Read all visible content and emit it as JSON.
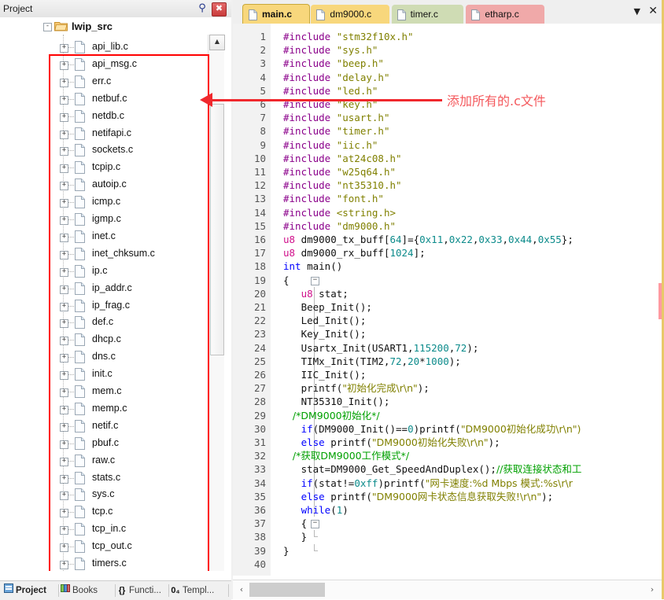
{
  "project_panel": {
    "title": "Project",
    "pin_icon": "pin-icon",
    "close_icon": "close-icon",
    "root": {
      "label": "lwip_src",
      "expander": "-",
      "icon": "folder-icon"
    },
    "files": [
      "api_lib.c",
      "api_msg.c",
      "err.c",
      "netbuf.c",
      "netdb.c",
      "netifapi.c",
      "sockets.c",
      "tcpip.c",
      "autoip.c",
      "icmp.c",
      "igmp.c",
      "inet.c",
      "inet_chksum.c",
      "ip.c",
      "ip_addr.c",
      "ip_frag.c",
      "def.c",
      "dhcp.c",
      "dns.c",
      "init.c",
      "mem.c",
      "memp.c",
      "netif.c",
      "pbuf.c",
      "raw.c",
      "stats.c",
      "sys.c",
      "tcp.c",
      "tcp_in.c",
      "tcp_out.c",
      "timers.c"
    ],
    "expander_symbol": "+",
    "scrollbar": {
      "up_arrow": "▲",
      "down_arrow": "▼"
    },
    "bottom_tabs": [
      {
        "label": "Project",
        "icon": "project-icon",
        "active": true
      },
      {
        "label": "Books",
        "icon": "books-icon",
        "active": false
      },
      {
        "label": "Functi...",
        "icon": "{}",
        "active": false
      },
      {
        "label": "Templ...",
        "icon": "0₄",
        "active": false
      }
    ]
  },
  "editor": {
    "tabs": [
      {
        "label": "main.c",
        "color": "#f8d77c",
        "active": true
      },
      {
        "label": "dm9000.c",
        "color": "#f8d77c",
        "active": false
      },
      {
        "label": "timer.c",
        "color": "#cfdcb4",
        "active": false
      },
      {
        "label": "etharp.c",
        "color": "#f0a9a9",
        "active": false
      }
    ],
    "tab_menu_icon": "chevron-down-icon",
    "tab_close_icon": "close-icon",
    "hscroll": {
      "left_arrow": "‹",
      "right_arrow": "›"
    },
    "lines": [
      {
        "n": 1,
        "segs": [
          {
            "t": "#include ",
            "c": "k-pre"
          },
          {
            "t": "\"stm32f10x.h\"",
            "c": "k-str"
          }
        ]
      },
      {
        "n": 2,
        "segs": [
          {
            "t": "#include ",
            "c": "k-pre"
          },
          {
            "t": "\"sys.h\"",
            "c": "k-str"
          }
        ]
      },
      {
        "n": 3,
        "segs": [
          {
            "t": "#include ",
            "c": "k-pre"
          },
          {
            "t": "\"beep.h\"",
            "c": "k-str"
          }
        ]
      },
      {
        "n": 4,
        "segs": [
          {
            "t": "#include ",
            "c": "k-pre"
          },
          {
            "t": "\"delay.h\"",
            "c": "k-str"
          }
        ]
      },
      {
        "n": 5,
        "segs": [
          {
            "t": "#include ",
            "c": "k-pre"
          },
          {
            "t": "\"led.h\"",
            "c": "k-str"
          }
        ]
      },
      {
        "n": 6,
        "segs": [
          {
            "t": "#include ",
            "c": "k-pre"
          },
          {
            "t": "\"key.h\"",
            "c": "k-str"
          }
        ]
      },
      {
        "n": 7,
        "segs": [
          {
            "t": "#include ",
            "c": "k-pre"
          },
          {
            "t": "\"usart.h\"",
            "c": "k-str"
          }
        ]
      },
      {
        "n": 8,
        "segs": [
          {
            "t": "#include ",
            "c": "k-pre"
          },
          {
            "t": "\"timer.h\"",
            "c": "k-str"
          }
        ]
      },
      {
        "n": 9,
        "segs": [
          {
            "t": "#include ",
            "c": "k-pre"
          },
          {
            "t": "\"iic.h\"",
            "c": "k-str"
          }
        ]
      },
      {
        "n": 10,
        "segs": [
          {
            "t": "#include ",
            "c": "k-pre"
          },
          {
            "t": "\"at24c08.h\"",
            "c": "k-str"
          }
        ]
      },
      {
        "n": 11,
        "segs": [
          {
            "t": "#include ",
            "c": "k-pre"
          },
          {
            "t": "\"w25q64.h\"",
            "c": "k-str"
          }
        ]
      },
      {
        "n": 12,
        "segs": [
          {
            "t": "#include ",
            "c": "k-pre"
          },
          {
            "t": "\"nt35310.h\"",
            "c": "k-str"
          }
        ]
      },
      {
        "n": 13,
        "segs": [
          {
            "t": "#include ",
            "c": "k-pre"
          },
          {
            "t": "\"font.h\"",
            "c": "k-str"
          }
        ]
      },
      {
        "n": 14,
        "segs": [
          {
            "t": "#include ",
            "c": "k-pre"
          },
          {
            "t": "<string.h>",
            "c": "k-str"
          }
        ]
      },
      {
        "n": 15,
        "segs": [
          {
            "t": "#include ",
            "c": "k-pre"
          },
          {
            "t": "\"dm9000.h\"",
            "c": "k-str"
          }
        ]
      },
      {
        "n": 16,
        "segs": [
          {
            "t": "u8",
            "c": "k-type"
          },
          {
            "t": " dm9000_tx_buff[",
            "c": "k-txt"
          },
          {
            "t": "64",
            "c": "k-num"
          },
          {
            "t": "]={",
            "c": "k-txt"
          },
          {
            "t": "0x11",
            "c": "k-num"
          },
          {
            "t": ",",
            "c": "k-txt"
          },
          {
            "t": "0x22",
            "c": "k-num"
          },
          {
            "t": ",",
            "c": "k-txt"
          },
          {
            "t": "0x33",
            "c": "k-num"
          },
          {
            "t": ",",
            "c": "k-txt"
          },
          {
            "t": "0x44",
            "c": "k-num"
          },
          {
            "t": ",",
            "c": "k-txt"
          },
          {
            "t": "0x55",
            "c": "k-num"
          },
          {
            "t": "};",
            "c": "k-txt"
          }
        ]
      },
      {
        "n": 17,
        "segs": [
          {
            "t": "u8",
            "c": "k-type"
          },
          {
            "t": " dm9000_rx_buff[",
            "c": "k-txt"
          },
          {
            "t": "1024",
            "c": "k-num"
          },
          {
            "t": "];",
            "c": "k-txt"
          }
        ]
      },
      {
        "n": 18,
        "segs": [
          {
            "t": "int",
            "c": "k-kw"
          },
          {
            "t": " main()",
            "c": "k-txt"
          }
        ]
      },
      {
        "n": 19,
        "segs": [
          {
            "t": "{",
            "c": "k-txt"
          }
        ],
        "fold": "start"
      },
      {
        "n": 20,
        "segs": [
          {
            "t": "   ",
            "c": "k-txt"
          },
          {
            "t": "u8",
            "c": "k-type"
          },
          {
            "t": " stat;",
            "c": "k-txt"
          }
        ],
        "fold": "body"
      },
      {
        "n": 21,
        "segs": [
          {
            "t": "   Beep_Init();",
            "c": "k-txt"
          }
        ],
        "fold": "body"
      },
      {
        "n": 22,
        "segs": [
          {
            "t": "   Led_Init();",
            "c": "k-txt"
          }
        ],
        "fold": "body"
      },
      {
        "n": 23,
        "segs": [
          {
            "t": "   Key_Init();",
            "c": "k-txt"
          }
        ],
        "fold": "body"
      },
      {
        "n": 24,
        "segs": [
          {
            "t": "   Usartx_Init(USART1,",
            "c": "k-txt"
          },
          {
            "t": "115200",
            "c": "k-num"
          },
          {
            "t": ",",
            "c": "k-txt"
          },
          {
            "t": "72",
            "c": "k-num"
          },
          {
            "t": ");",
            "c": "k-txt"
          }
        ],
        "fold": "body"
      },
      {
        "n": 25,
        "segs": [
          {
            "t": "   TIMx_Init(TIM2,",
            "c": "k-txt"
          },
          {
            "t": "72",
            "c": "k-num"
          },
          {
            "t": ",",
            "c": "k-txt"
          },
          {
            "t": "20",
            "c": "k-num"
          },
          {
            "t": "*",
            "c": "k-txt"
          },
          {
            "t": "1000",
            "c": "k-num"
          },
          {
            "t": ");",
            "c": "k-txt"
          }
        ],
        "fold": "body"
      },
      {
        "n": 26,
        "segs": [
          {
            "t": "   IIC_Init();",
            "c": "k-txt"
          }
        ],
        "fold": "body"
      },
      {
        "n": 27,
        "segs": [
          {
            "t": "   printf(",
            "c": "k-txt"
          },
          {
            "t": "\"初始化完成\\r\\n\"",
            "c": "k-str"
          },
          {
            "t": ");",
            "c": "k-txt"
          }
        ],
        "fold": "body"
      },
      {
        "n": 28,
        "segs": [
          {
            "t": "   NT35310_Init();",
            "c": "k-txt"
          }
        ],
        "fold": "body"
      },
      {
        "n": 29,
        "segs": [
          {
            "t": "   /*DM9000初始化*/",
            "c": "k-cmt"
          }
        ],
        "fold": "body"
      },
      {
        "n": 30,
        "segs": [
          {
            "t": "   ",
            "c": "k-txt"
          },
          {
            "t": "if",
            "c": "k-kw"
          },
          {
            "t": "(DM9000_Init()==",
            "c": "k-txt"
          },
          {
            "t": "0",
            "c": "k-num"
          },
          {
            "t": ")printf(",
            "c": "k-txt"
          },
          {
            "t": "\"DM9000初始化成功\\r\\n\")",
            "c": "k-str"
          }
        ],
        "fold": "body"
      },
      {
        "n": 31,
        "segs": [
          {
            "t": "   ",
            "c": "k-txt"
          },
          {
            "t": "else",
            "c": "k-kw"
          },
          {
            "t": " printf(",
            "c": "k-txt"
          },
          {
            "t": "\"DM9000初始化失败\\r\\n\"",
            "c": "k-str"
          },
          {
            "t": ");",
            "c": "k-txt"
          }
        ],
        "fold": "body"
      },
      {
        "n": 32,
        "segs": [
          {
            "t": "   /*获取DM9000工作模式*/",
            "c": "k-cmt"
          }
        ],
        "fold": "body"
      },
      {
        "n": 33,
        "segs": [
          {
            "t": "   stat=DM9000_Get_SpeedAndDuplex();",
            "c": "k-txt"
          },
          {
            "t": "//获取连接状态和工",
            "c": "k-cmt"
          }
        ],
        "fold": "body"
      },
      {
        "n": 34,
        "segs": [
          {
            "t": "   ",
            "c": "k-txt"
          },
          {
            "t": "if",
            "c": "k-kw"
          },
          {
            "t": "(stat!=",
            "c": "k-txt"
          },
          {
            "t": "0xff",
            "c": "k-num"
          },
          {
            "t": ")printf(",
            "c": "k-txt"
          },
          {
            "t": "\"网卡速度:%d Mbps 模式:%s\\r\\r",
            "c": "k-str"
          }
        ],
        "fold": "body"
      },
      {
        "n": 35,
        "segs": [
          {
            "t": "   ",
            "c": "k-txt"
          },
          {
            "t": "else",
            "c": "k-kw"
          },
          {
            "t": " printf(",
            "c": "k-txt"
          },
          {
            "t": "\"DM9000网卡状态信息获取失败!\\r\\n\"",
            "c": "k-str"
          },
          {
            "t": ");",
            "c": "k-txt"
          }
        ],
        "fold": "body"
      },
      {
        "n": 36,
        "segs": [
          {
            "t": "   ",
            "c": "k-txt"
          },
          {
            "t": "while",
            "c": "k-kw"
          },
          {
            "t": "(",
            "c": "k-txt"
          },
          {
            "t": "1",
            "c": "k-num"
          },
          {
            "t": ")",
            "c": "k-txt"
          }
        ],
        "fold": "body"
      },
      {
        "n": 37,
        "segs": [
          {
            "t": "   {",
            "c": "k-txt"
          }
        ],
        "fold": "inner-start"
      },
      {
        "n": 38,
        "segs": [
          {
            "t": "   }",
            "c": "k-txt"
          }
        ],
        "fold": "inner-end"
      },
      {
        "n": 39,
        "segs": [
          {
            "t": "}",
            "c": "k-txt"
          }
        ],
        "fold": "end"
      },
      {
        "n": 40,
        "segs": [
          {
            "t": "",
            "c": "k-txt"
          }
        ]
      }
    ]
  },
  "annotation": {
    "text": "添加所有的.c文件",
    "color": "#f0282d"
  }
}
